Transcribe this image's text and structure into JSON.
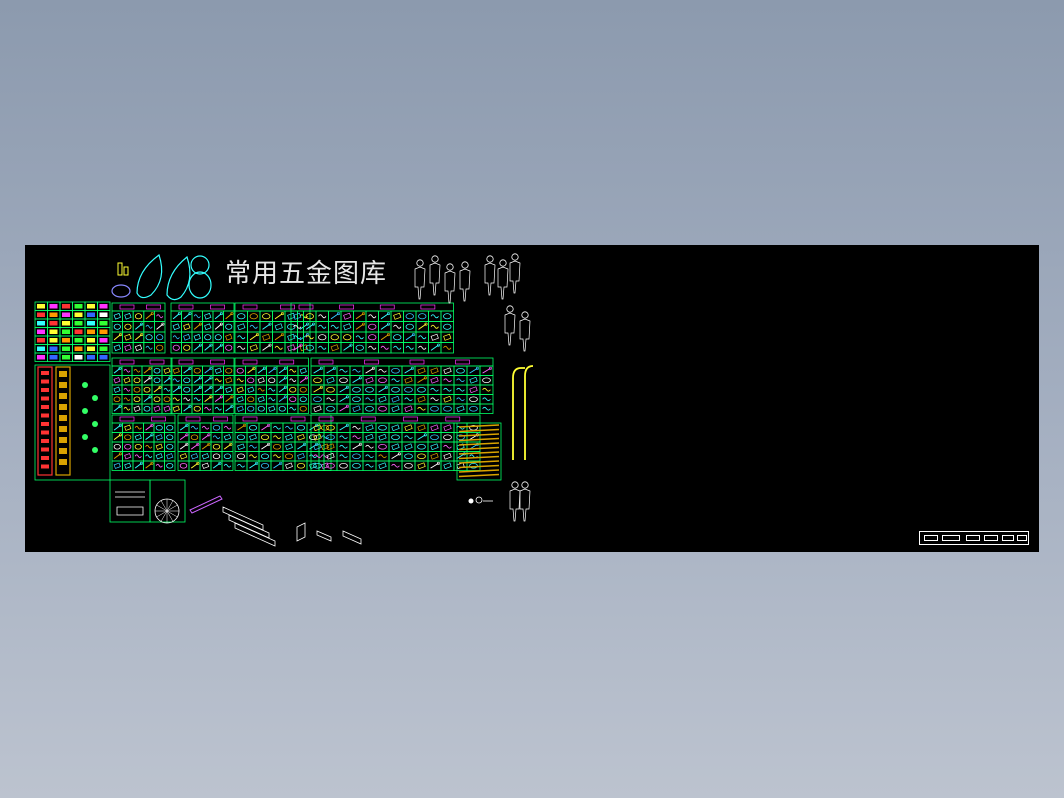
{
  "drawing": {
    "title": "常用五金图库",
    "colors": {
      "background": "#000000",
      "grid": "#00ff66",
      "labels": "#ff33ff",
      "title": "#e6e6e6",
      "cyan": "#33ffff",
      "yellow": "#ffff33",
      "orange": "#d9a300",
      "white": "#ffffff"
    },
    "icons": [
      "bear-icon",
      "leaf-icon",
      "people-silhouette-icon",
      "hardware-part-icon",
      "handle-icon"
    ]
  }
}
